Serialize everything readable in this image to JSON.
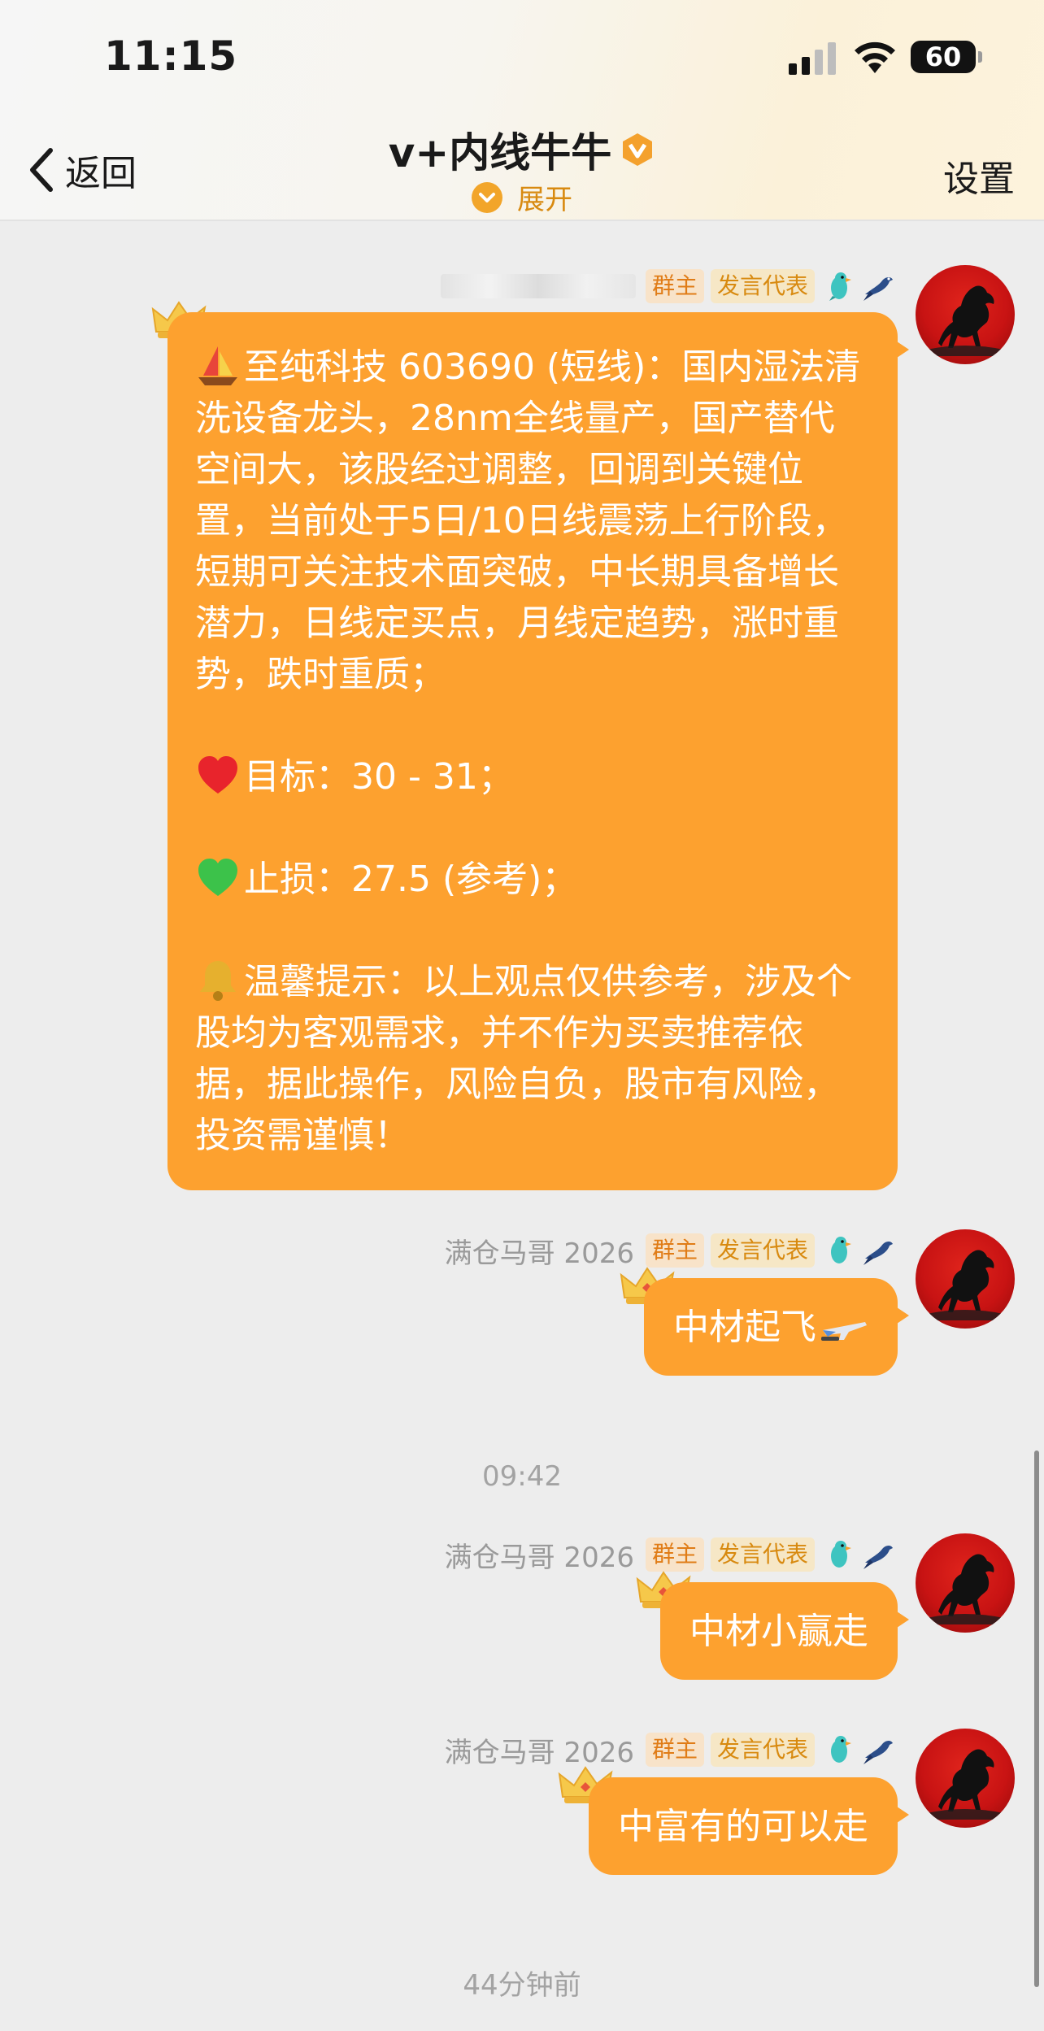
{
  "status_bar": {
    "time": "11:15",
    "battery": "60"
  },
  "header": {
    "back_label": "返回",
    "title": "v+内线牛牛",
    "expand_label": "展开",
    "settings_label": "设置"
  },
  "messages": [
    {
      "sender": "",
      "tags": [
        "群主",
        "发言代表"
      ],
      "paragraphs": [
        "至纯科技 603690 (短线)：国内湿法清洗设备龙头，28nm全线量产，国产替代空间大，该股经过调整，回调到关键位置，当前处于5日/10日线震荡上行阶段，短期可关注技术面突破，中长期具备增长潜力，日线定买点，月线定趋势，涨时重势，跌时重质；",
        "目标：30 - 31；",
        "止损：27.5 (参考)；",
        "温馨提示：以上观点仅供参考，涉及个股均为客观需求，并不作为买卖推荐依据，据此操作，风险自负，股市有风险，投资需谨慎！"
      ],
      "paragraph_icons": [
        "sailboat-icon",
        "red-heart-icon",
        "green-heart-icon",
        "bell-icon"
      ]
    },
    {
      "sender": "满仓马哥 2026",
      "tags": [
        "群主",
        "发言代表"
      ],
      "text": "中材起飞"
    },
    {
      "sender": "满仓马哥 2026",
      "tags": [
        "群主",
        "发言代表"
      ],
      "text": "中材小赢走"
    },
    {
      "sender": "满仓马哥 2026",
      "tags": [
        "群主",
        "发言代表"
      ],
      "text": "中富有的可以走"
    }
  ],
  "time_labels": [
    "09:42",
    "44分钟前"
  ],
  "colors": {
    "bubble": "#fda12f",
    "background": "#ededed",
    "accent": "#f2a52a"
  }
}
